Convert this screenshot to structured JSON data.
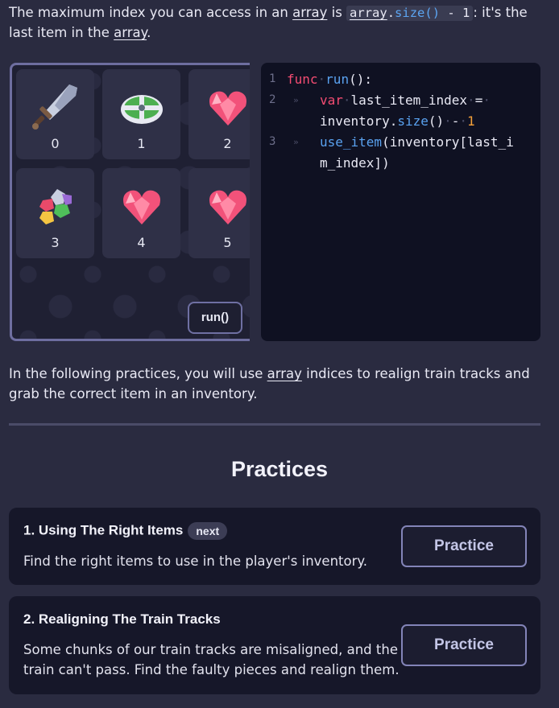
{
  "intro": {
    "part1": "The maximum index you can access in an ",
    "array1": "array",
    "part2": " is ",
    "code_array": "array",
    "code_dot": ".",
    "code_size": "size",
    "code_parens": "()",
    "code_minus": " - 1",
    "part3": ": it's the last item in the ",
    "array2": "array",
    "part4": "."
  },
  "inventory": {
    "slots": [
      {
        "index": "0",
        "icon": "sword-icon"
      },
      {
        "index": "1",
        "icon": "shield-icon"
      },
      {
        "index": "2",
        "icon": "heart-gem-icon"
      },
      {
        "index": "3",
        "icon": "gem-cluster-icon"
      },
      {
        "index": "4",
        "icon": "heart-gem-icon"
      },
      {
        "index": "5",
        "icon": "heart-gem-icon"
      }
    ],
    "run_label": "run()"
  },
  "code": {
    "line_numbers": [
      "1",
      "2",
      "3"
    ],
    "l1_kw": "func",
    "l1_name": "run",
    "l1_rest": "():",
    "l2_var": "var",
    "l2_name": "last_item_index",
    "l2_eq": "=",
    "l2b_obj": "inventory.",
    "l2b_size": "size",
    "l2b_parens": "()",
    "l2b_minus": "-",
    "l2b_num": "1",
    "l3_fn": "use_item",
    "l3_rest": "(inventory[last_i",
    "l3b": "m_index])"
  },
  "para2": {
    "part1": "In the following practices, you will use ",
    "array": "array",
    "part2": " indices to realign train tracks and grab the correct item in an inventory."
  },
  "practices": {
    "title": "Practices",
    "items": [
      {
        "title": "1. Using The Right Items",
        "badge": "next",
        "description": "Find the right items to use in the player's inventory.",
        "button": "Practice"
      },
      {
        "title": "2. Realigning The Train Tracks",
        "description": "Some chunks of our train tracks are misaligned, and the train can't pass. Find the faulty pieces and realign them.",
        "button": "Practice"
      }
    ]
  }
}
